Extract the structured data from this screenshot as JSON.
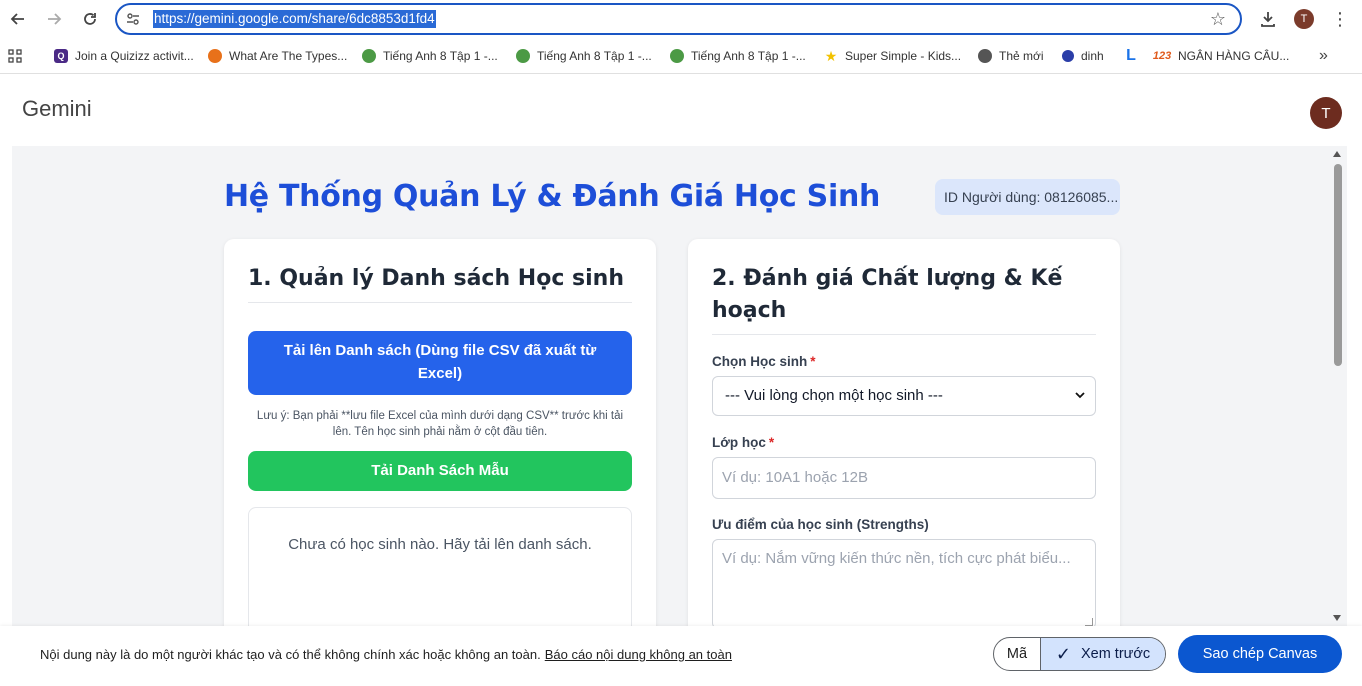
{
  "browser": {
    "url": "https://gemini.google.com/share/6dc8853d1fd4",
    "profile_initial": "T",
    "bookmarks": [
      {
        "label": "Join a Quizizz activit...",
        "icon": "quizizz-icon",
        "color": "#4b2a86"
      },
      {
        "label": "What Are The Types...",
        "icon": "orange-site-icon",
        "color": "#e8711a"
      },
      {
        "label": "Tiếng Anh 8 Tập 1 -...",
        "icon": "globe-green-icon",
        "color": "#4c9a45"
      },
      {
        "label": "Tiếng Anh 8 Tập 1 -...",
        "icon": "globe-green-icon",
        "color": "#4c9a45"
      },
      {
        "label": "Tiếng Anh 8 Tập 1 -...",
        "icon": "globe-green-icon",
        "color": "#4c9a45"
      },
      {
        "label": "Super Simple - Kids...",
        "icon": "star-yellow-icon",
        "color": "#f2c200"
      },
      {
        "label": "Thẻ mới",
        "icon": "globe-icon",
        "color": "#555555"
      },
      {
        "label": "dinh",
        "icon": "dinh-icon",
        "color": "#2b3ea8"
      },
      {
        "label": "",
        "icon": "l-blue-icon",
        "color": "#1a73e8"
      },
      {
        "label": "NGÂN HÀNG CÂU...",
        "icon": "num-123-icon",
        "color": "#e05a1c"
      }
    ]
  },
  "gemini": {
    "logo": "Gemini",
    "avatar_initial": "T"
  },
  "app": {
    "title": "Hệ Thống Quản Lý & Đánh Giá Học Sinh",
    "user_id": "ID Người dùng: 08126085..."
  },
  "left_card": {
    "heading": "1. Quản lý Danh sách Học sinh",
    "upload_button": "Tải lên Danh sách (Dùng file CSV đã xuất từ Excel)",
    "note": "Lưu ý: Bạn phải **lưu file Excel của mình dưới dạng CSV** trước khi tải lên. Tên học sinh phải nằm ở cột đầu tiên.",
    "template_button": "Tải Danh Sách Mẫu",
    "empty_message": "Chưa có học sinh nào. Hãy tải lên danh sách."
  },
  "right_card": {
    "heading": "2. Đánh giá Chất lượng & Kế hoạch",
    "student_label": "Chọn Học sinh",
    "student_select_value": "--- Vui lòng chọn một học sinh ---",
    "class_label": "Lớp học",
    "class_placeholder": "Ví dụ: 10A1 hoặc 12B",
    "strengths_label": "Ưu điểm của học sinh (Strengths)",
    "strengths_placeholder": "Ví dụ: Nắm vững kiến thức nền, tích cực phát biểu..."
  },
  "bottom_bar": {
    "disclaimer": "Nội dung này là do một người khác tạo và có thể không chính xác hoặc không an toàn.",
    "report_link": "Báo cáo nội dung không an toàn",
    "code_tab": "Mã",
    "preview_tab": "Xem trước",
    "copy_button": "Sao chép Canvas"
  }
}
